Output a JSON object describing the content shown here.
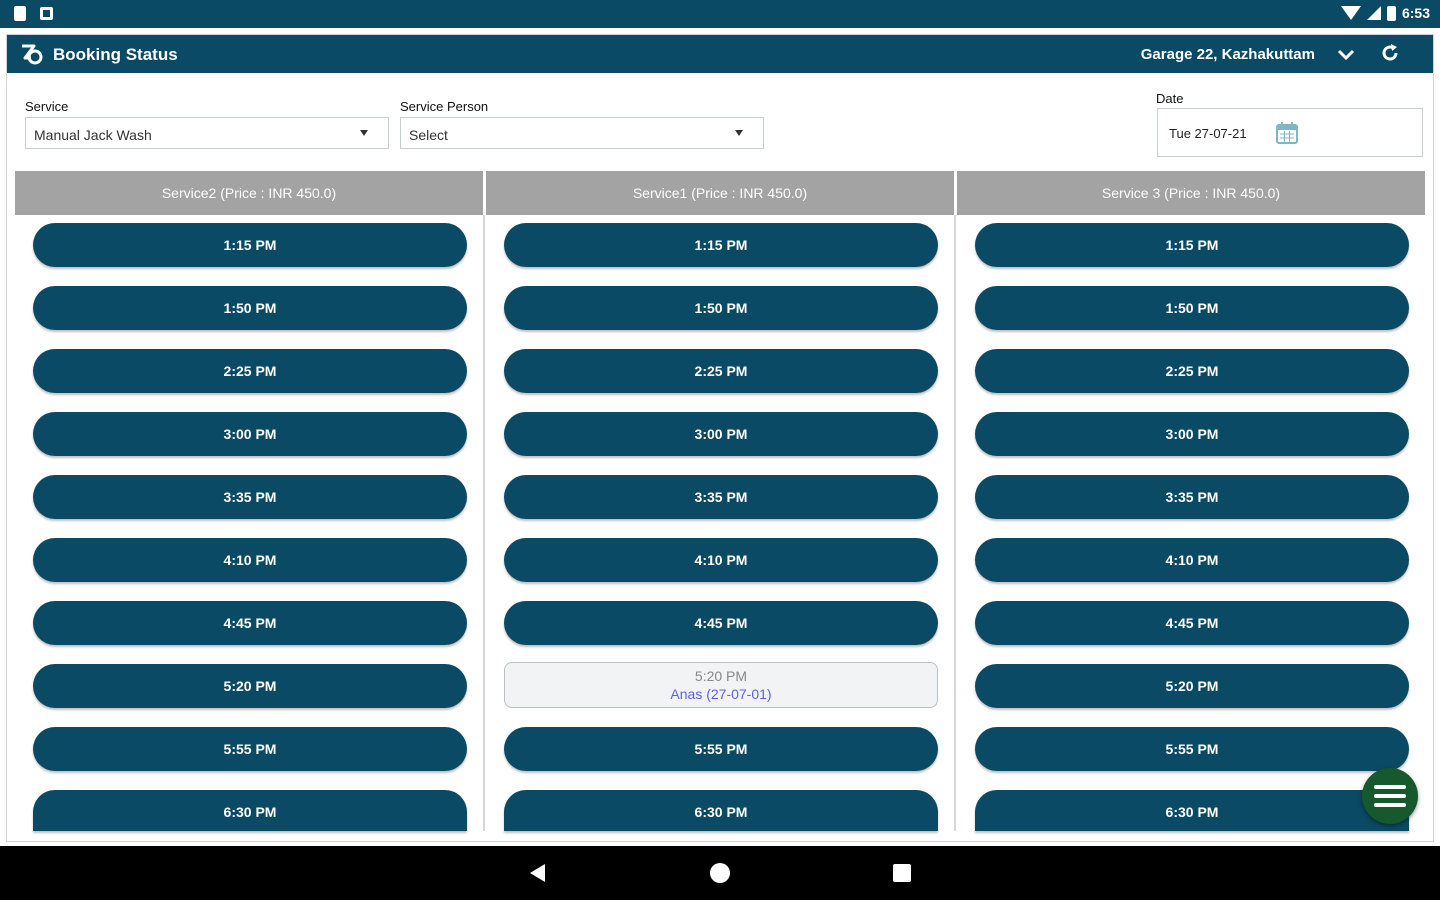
{
  "status_bar": {
    "time": "6:53"
  },
  "app_bar": {
    "title": "Booking Status",
    "location": "Garage 22, Kazhakuttam"
  },
  "filters": {
    "service_label": "Service",
    "service_value": "Manual Jack Wash",
    "person_label": "Service Person",
    "person_value": "Select",
    "date_label": "Date",
    "date_value": "Tue 27-07-21"
  },
  "columns": [
    {
      "header": "Service2 (Price : INR 450.0)",
      "slots": [
        {
          "time": "1:15 PM"
        },
        {
          "time": "1:50 PM"
        },
        {
          "time": "2:25 PM"
        },
        {
          "time": "3:00 PM"
        },
        {
          "time": "3:35 PM"
        },
        {
          "time": "4:10 PM"
        },
        {
          "time": "4:45 PM"
        },
        {
          "time": "5:20 PM"
        },
        {
          "time": "5:55 PM"
        },
        {
          "time": "6:30 PM"
        }
      ]
    },
    {
      "header": "Service1 (Price : INR 450.0)",
      "slots": [
        {
          "time": "1:15 PM"
        },
        {
          "time": "1:50 PM"
        },
        {
          "time": "2:25 PM"
        },
        {
          "time": "3:00 PM"
        },
        {
          "time": "3:35 PM"
        },
        {
          "time": "4:10 PM"
        },
        {
          "time": "4:45 PM"
        },
        {
          "time": "5:20 PM",
          "booked_by": "Anas (27-07-01)"
        },
        {
          "time": "5:55 PM"
        },
        {
          "time": "6:30 PM"
        }
      ]
    },
    {
      "header": "Service 3 (Price : INR 450.0)",
      "slots": [
        {
          "time": "1:15 PM"
        },
        {
          "time": "1:50 PM"
        },
        {
          "time": "2:25 PM"
        },
        {
          "time": "3:00 PM"
        },
        {
          "time": "3:35 PM"
        },
        {
          "time": "4:10 PM"
        },
        {
          "time": "4:45 PM"
        },
        {
          "time": "5:20 PM"
        },
        {
          "time": "5:55 PM"
        },
        {
          "time": "6:30 PM"
        }
      ]
    }
  ],
  "colors": {
    "primary": "#0b4a64",
    "column_header": "#a3a3a3",
    "fab": "#15592d",
    "booked_name": "#5d5ff0"
  },
  "icons": {
    "logo": "app-logo-icon",
    "dropdown": "chevron-down-icon",
    "refresh": "refresh-icon",
    "calendar": "calendar-icon",
    "menu": "menu-icon"
  }
}
